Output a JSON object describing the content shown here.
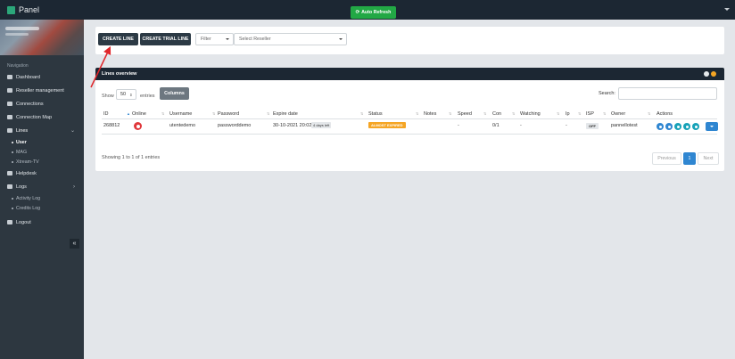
{
  "app": {
    "title": "Panel"
  },
  "sidebar": {
    "heading": "Navigation",
    "items": [
      {
        "label": "Dashboard"
      },
      {
        "label": "Reseller management"
      },
      {
        "label": "Connections"
      },
      {
        "label": "Connection Map"
      },
      {
        "label": "Lines"
      },
      {
        "label": "Helpdesk"
      },
      {
        "label": "Logs"
      },
      {
        "label": "Logout"
      }
    ],
    "lines_sub": [
      {
        "label": "User"
      },
      {
        "label": "MAG"
      },
      {
        "label": "Xtream-TV"
      }
    ],
    "logs_sub": [
      {
        "label": "Activity Log"
      },
      {
        "label": "Credits Log"
      }
    ],
    "collapse_glyph": "«"
  },
  "toolbar": {
    "create_line": "CREATE LINE",
    "create_trial_line": "CREATE TRIAL LINE",
    "filter_value": "Filter",
    "reseller_value": "Select Reseller",
    "auto_refresh": "Auto Refresh"
  },
  "lines": {
    "header": "Lines overview",
    "show_label": "Show",
    "page_length": "50",
    "entries_label": "entries",
    "columns_button": "Columns",
    "search_label": "Search:",
    "columns": [
      "ID",
      "Online",
      "Username",
      "Password",
      "Expire date",
      "Status",
      "Notes",
      "Speed",
      "Con",
      "Watching",
      "Ip",
      "ISP",
      "Owner",
      "Actions"
    ],
    "row": {
      "id": "268812",
      "username": "utentedemo",
      "password": "passworddemo",
      "expire": "30-10-2021 20:02",
      "days_left": "4 days left",
      "status": "ALMOST EXPIRED",
      "speed": "-",
      "con": "0/1",
      "watching": "-",
      "ip": "-",
      "isp": "OFF",
      "owner": "pannellotest"
    },
    "info": "Showing 1 to 1 of 1 entries",
    "pagination": {
      "prev": "Previous",
      "current": "1",
      "next": "Next"
    }
  },
  "colors": {
    "topbar": "#1c2733",
    "sidebar": "#2d3740",
    "green": "#22a845",
    "blue": "#2f86d1",
    "expired": "#f5a524",
    "offline": "#e0373b",
    "arrow": "#e0262a"
  }
}
